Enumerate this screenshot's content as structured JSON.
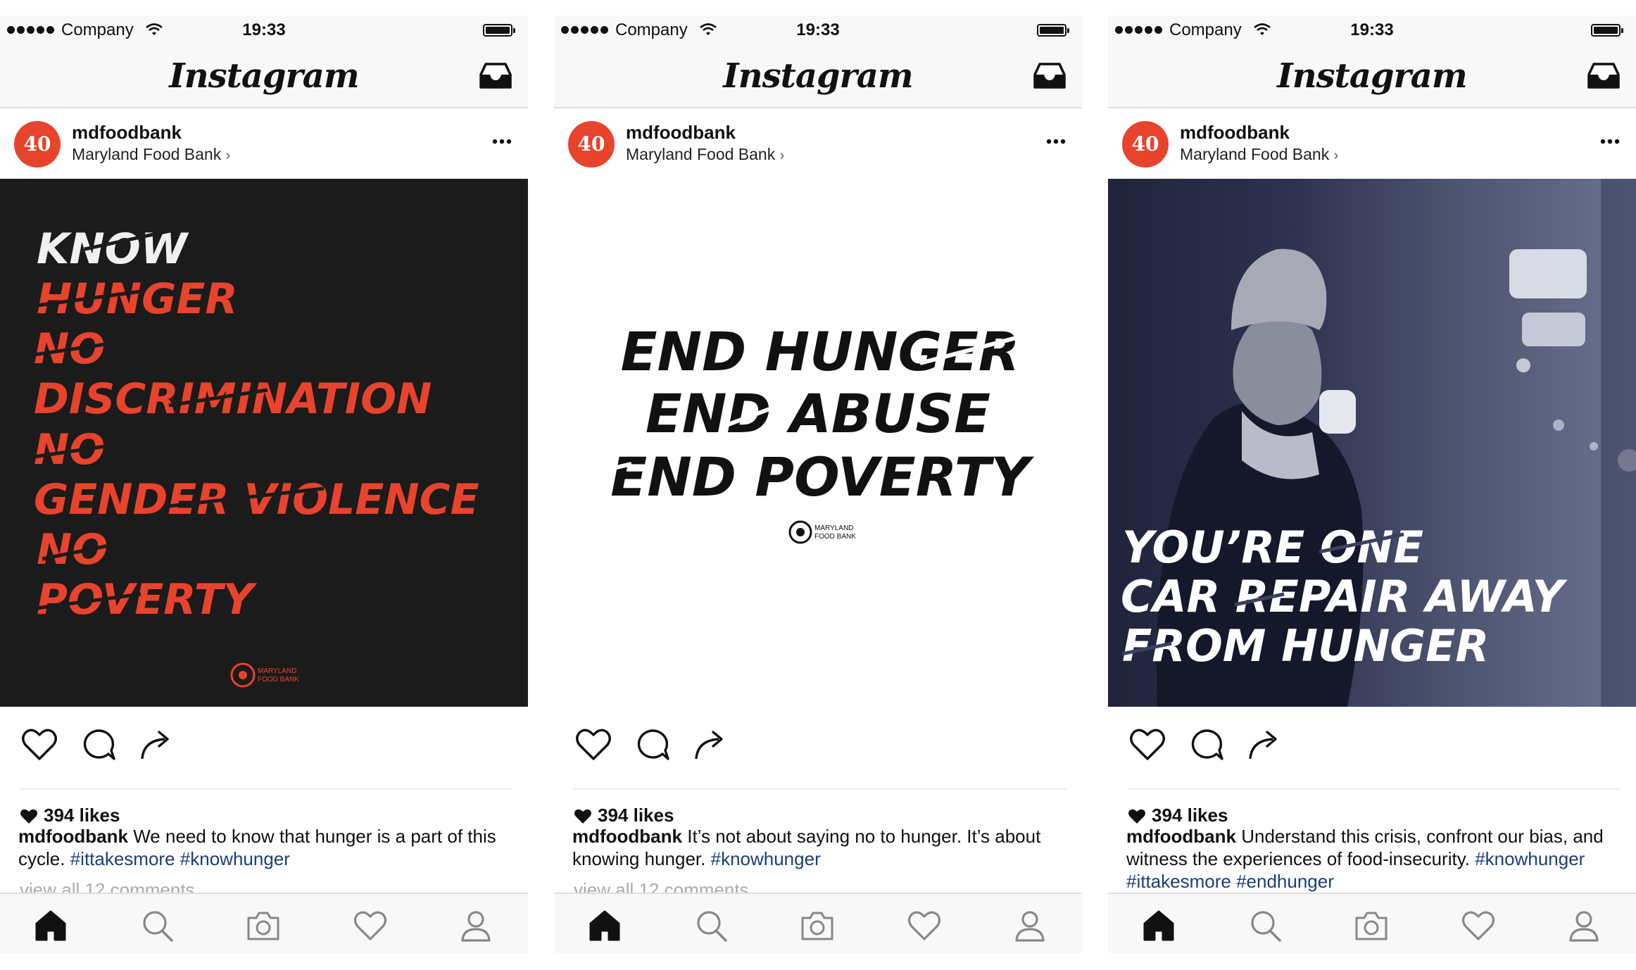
{
  "status_bar": {
    "carrier": "Company",
    "time": "19:33"
  },
  "app": {
    "name": "Instagram"
  },
  "icons": {
    "signal": "signal-dots-icon",
    "wifi": "wifi-icon",
    "battery": "battery-icon",
    "inbox": "inbox-icon",
    "more": "more-options-icon",
    "like": "heart-outline-icon",
    "comment": "comment-bubble-icon",
    "share": "share-arrow-icon",
    "home": "home-icon",
    "search": "search-icon",
    "camera": "camera-icon",
    "activity": "heart-outline-icon",
    "profile": "profile-icon"
  },
  "colors": {
    "brand_red": "#e8432c",
    "hashtag": "#1b3f79",
    "muted": "#aaaaaa"
  },
  "posts": [
    {
      "username": "mdfoodbank",
      "location": "Maryland Food Bank",
      "avatar_text": "40",
      "image_lines": [
        "KNOW",
        "HUNGER",
        "NO",
        "DISCRIMINATION",
        "NO",
        "GENDER VIOLENCE",
        "NO",
        "POVERTY"
      ],
      "image_logo": [
        "MARYLAND",
        "FOOD BANK"
      ],
      "likes": "394 likes",
      "caption_user": "mdfoodbank",
      "caption_text": "We need to know that hunger is a part of this cycle.",
      "hashtags": [
        "#ittakesmore",
        "#knowhunger"
      ],
      "view_comments": "view all 12 comments"
    },
    {
      "username": "mdfoodbank",
      "location": "Maryland Food Bank",
      "avatar_text": "40",
      "image_lines": [
        "END HUNGER",
        "END ABUSE",
        "END POVERTY"
      ],
      "image_logo": [
        "MARYLAND",
        "FOOD BANK"
      ],
      "likes": "394 likes",
      "caption_user": "mdfoodbank",
      "caption_text": "It’s not about saying no to hunger. It’s about knowing hunger.",
      "hashtags": [
        "#knowhunger"
      ],
      "view_comments": "view all 12 comments"
    },
    {
      "username": "mdfoodbank",
      "location": "Maryland Food Bank",
      "avatar_text": "40",
      "image_lines": [
        "YOU’RE ONE",
        "CAR REPAIR AWAY",
        "FROM HUNGER"
      ],
      "likes": "394 likes",
      "caption_user": "mdfoodbank",
      "caption_text": "Understand this crisis, confront our bias, and witness the experiences of food-insecurity.",
      "hashtags": [
        "#knowhunger",
        "#ittakesmore",
        "#endhunger"
      ]
    }
  ]
}
